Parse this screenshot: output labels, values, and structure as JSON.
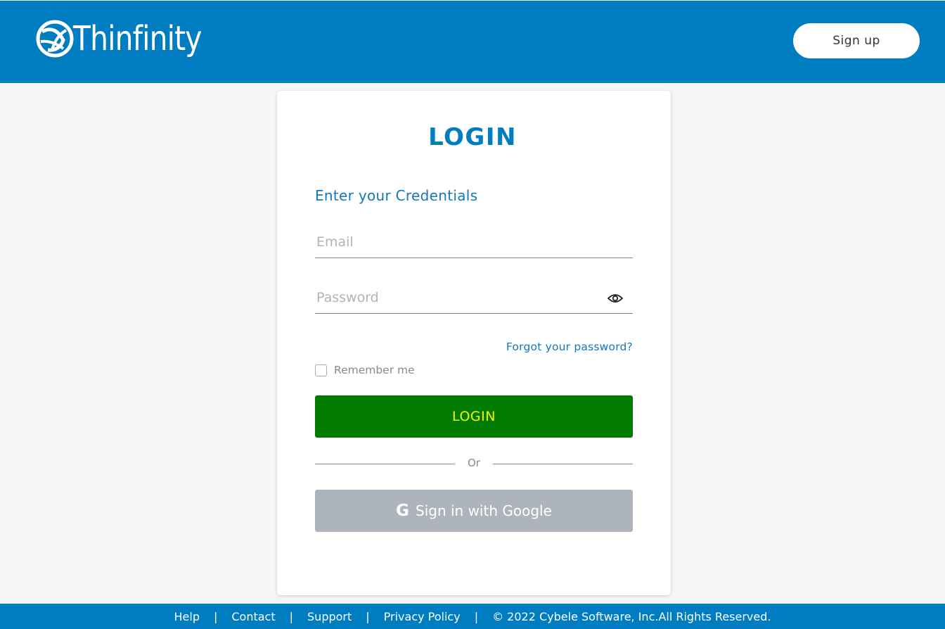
{
  "header": {
    "brand_name": "Thinfinity",
    "signup_label": "Sign up",
    "background_color": "#007dc1"
  },
  "login_card": {
    "title": "LOGIN",
    "subtitle": "Enter your Credentials",
    "email": {
      "placeholder": "Email",
      "value": ""
    },
    "password": {
      "placeholder": "Password",
      "value": "",
      "toggle_icon": "eye-icon"
    },
    "forgot_password_label": "Forgot your password?",
    "remember_me": {
      "label": "Remember me",
      "checked": false
    },
    "login_button_label": "LOGIN",
    "login_button_color": "#007b00",
    "login_button_text_color": "#f4f400",
    "divider_label": "Or",
    "google_button": {
      "icon": "google-g-icon",
      "icon_glyph": "G",
      "label": "Sign in with Google"
    }
  },
  "footer": {
    "links": [
      {
        "label": "Help"
      },
      {
        "label": "Contact"
      },
      {
        "label": "Support"
      },
      {
        "label": "Privacy Policy"
      }
    ],
    "separator": "|",
    "copyright": "© 2022 Cybele Software, Inc.All Rights Reserved."
  }
}
